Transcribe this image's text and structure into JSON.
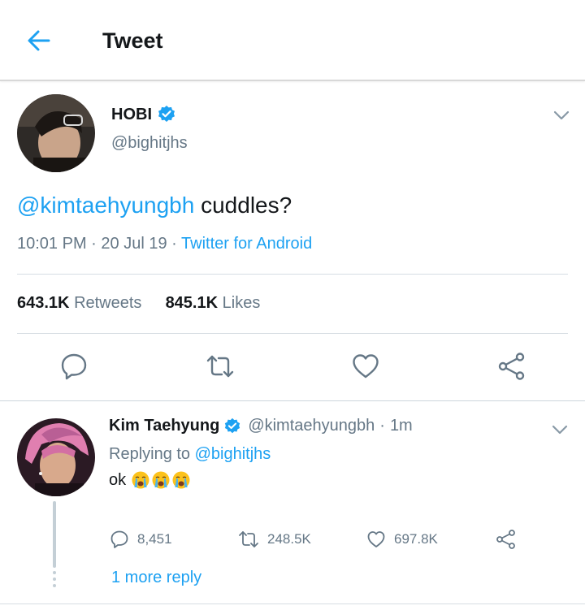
{
  "header": {
    "title": "Tweet",
    "back_icon": "arrow-left-icon"
  },
  "tweet": {
    "author_name": "HOBI",
    "author_handle": "@bighitjhs",
    "text_mention": "@kimtaehyungbh",
    "text_body": " cuddles?",
    "time": "10:01 PM",
    "date": "20 Jul 19",
    "source": "Twitter for Android",
    "retweets_count": "643.1K",
    "retweets_label": "Retweets",
    "likes_count": "845.1K",
    "likes_label": "Likes"
  },
  "reply": {
    "author_name": "Kim Taehyung",
    "author_handle": "@kimtaehyungbh",
    "age": "1m",
    "replying_prefix": "Replying to",
    "replying_to": "@bighitjhs",
    "text": "ok",
    "emojis": [
      "loudly-crying-face",
      "loudly-crying-face",
      "loudly-crying-face"
    ],
    "reply_count": "8,451",
    "retweet_count": "248.5K",
    "like_count": "697.8K",
    "more_replies": "1 more reply"
  },
  "colors": {
    "accent": "#1da1f2",
    "secondary_text": "#657786",
    "divider": "#d6dde3"
  }
}
